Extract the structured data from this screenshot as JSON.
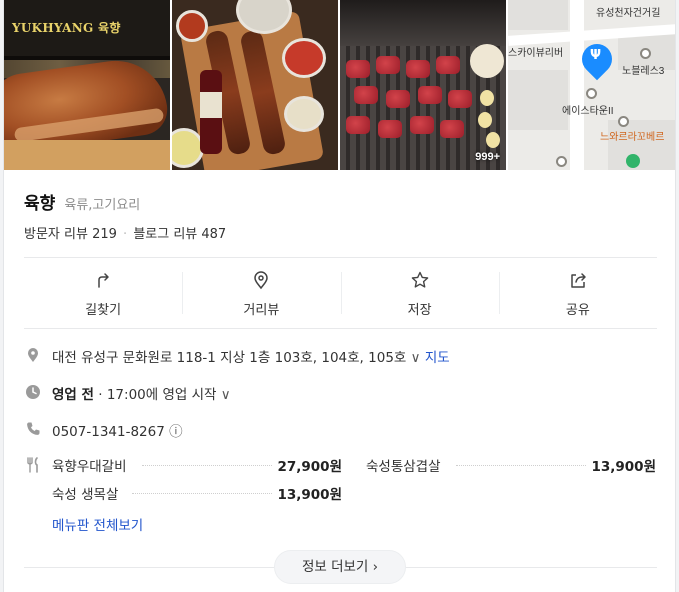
{
  "photos": {
    "sign_text": "YUKHYANG 육향",
    "count_badge": "999+",
    "map": {
      "labels": [
        "유성천자건거길",
        "스카이뷰리버",
        "노블레스3",
        "에이스타운II",
        "느와르라꼬베르"
      ]
    }
  },
  "place": {
    "name": "육향",
    "category": "육류,고기요리",
    "visitor_review": "방문자 리뷰 219",
    "separator": "·",
    "blog_review": "블로그 리뷰 487"
  },
  "actions": [
    {
      "label": "길찾기",
      "icon": "directions-icon"
    },
    {
      "label": "거리뷰",
      "icon": "streetview-icon"
    },
    {
      "label": "저장",
      "icon": "star-icon"
    },
    {
      "label": "공유",
      "icon": "share-icon"
    }
  ],
  "info": {
    "address": "대전 유성구 문화원로 118-1 지상 1층 103호, 104호, 105호",
    "address_chevron": "∨",
    "map_link": "지도",
    "status_label": "영업 전",
    "status_detail": "· 17:00에 영업 시작",
    "status_chevron": "∨",
    "phone": "0507-1341-8267",
    "phone_info": "ⓘ",
    "menu_items": [
      {
        "name": "육향우대갈비",
        "price": "27,900원"
      },
      {
        "name": "숙성통삼겹살",
        "price": "13,900원"
      },
      {
        "name": "숙성 생목살",
        "price": "13,900원"
      }
    ],
    "menu_all_link": "메뉴판 전체보기"
  },
  "more_button": "정보 더보기 ›",
  "colors": {
    "link": "#2255cc",
    "pin": "#1a8cff",
    "icon_gray": "#999999"
  }
}
